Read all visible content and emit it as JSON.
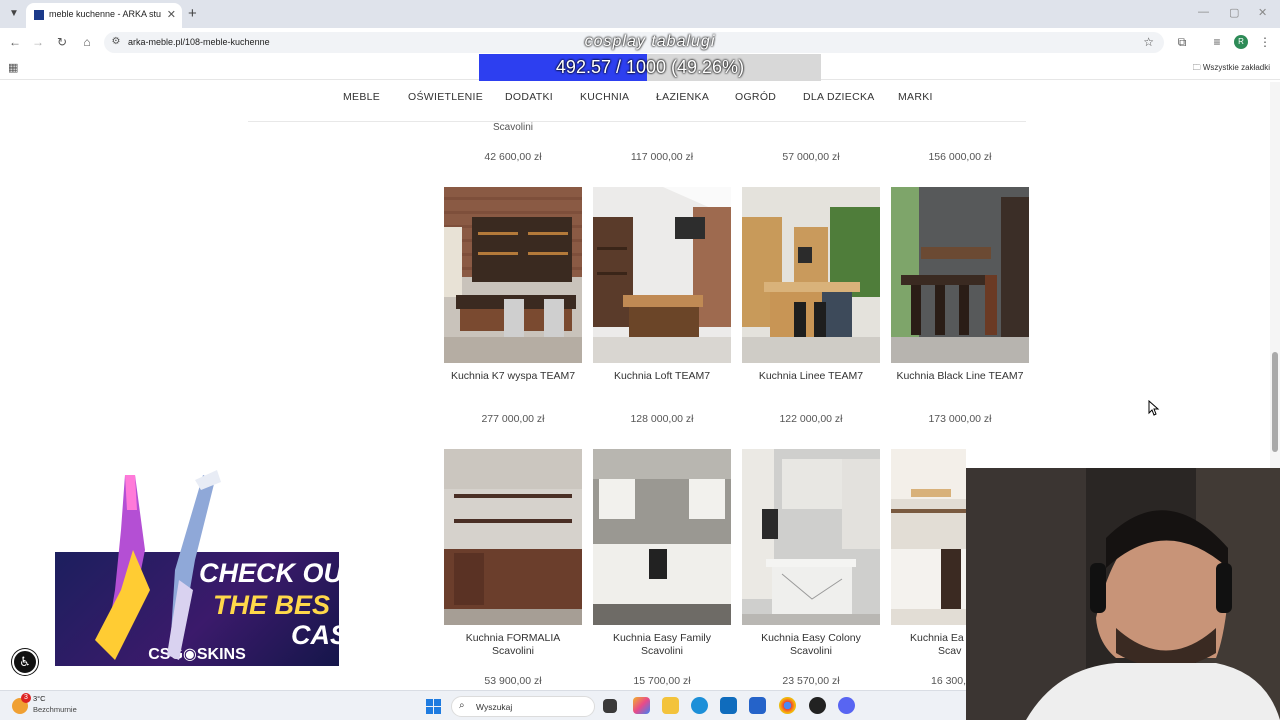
{
  "browser": {
    "tab_title": "meble kuchenne - ARKA studio",
    "url": "arka-meble.pl/108-meble-kuchenne",
    "bookmarks_label": "Wszystkie zakładki",
    "profile_initial": "R"
  },
  "overlay": {
    "title": "cosplay tabalugi",
    "progress_text": "492.57 / 1000 (49.26%)",
    "progress_fraction": 0.4926
  },
  "nav": [
    "MEBLE",
    "OŚWIETLENIE",
    "DODATKI",
    "KUCHNIA",
    "ŁAZIENKA",
    "OGRÓD",
    "DLA DZIECKA",
    "MARKI"
  ],
  "partial_row": {
    "name_fragment": "Scavolini",
    "prices": [
      "42 600,00 zł",
      "117 000,00 zł",
      "57 000,00 zł",
      "156 000,00 zł"
    ]
  },
  "row2": [
    {
      "name": "Kuchnia K7 wyspa TEAM7",
      "price": "277 000,00 zł"
    },
    {
      "name": "Kuchnia Loft TEAM7",
      "price": "128 000,00 zł"
    },
    {
      "name": "Kuchnia Linee TEAM7",
      "price": "122 000,00 zł"
    },
    {
      "name": "Kuchnia Black Line TEAM7",
      "price": "173 000,00 zł"
    }
  ],
  "row3": [
    {
      "name": "Kuchnia FORMALIA Scavolini",
      "price": "53 900,00 zł"
    },
    {
      "name": "Kuchnia Easy Family Scavolini",
      "price": "15 700,00 zł"
    },
    {
      "name": "Kuchnia Easy Colony Scavolini",
      "price": "23 570,00 zł"
    },
    {
      "name": "Kuchnia Ea",
      "name2": "Scav",
      "price": "16 300,"
    }
  ],
  "ad": {
    "line1": "CHECK OU",
    "line2": "THE BES",
    "line3": "CASE",
    "brand": "CSG◉SKINS"
  },
  "taskbar": {
    "temperature": "3°C",
    "weather": "Bezchmurnie",
    "weather_badge": "3",
    "search_placeholder": "Wyszukaj"
  },
  "colors": {
    "progress_fill": "#2d3ff0",
    "progress_bg": "#d8d8d8"
  }
}
